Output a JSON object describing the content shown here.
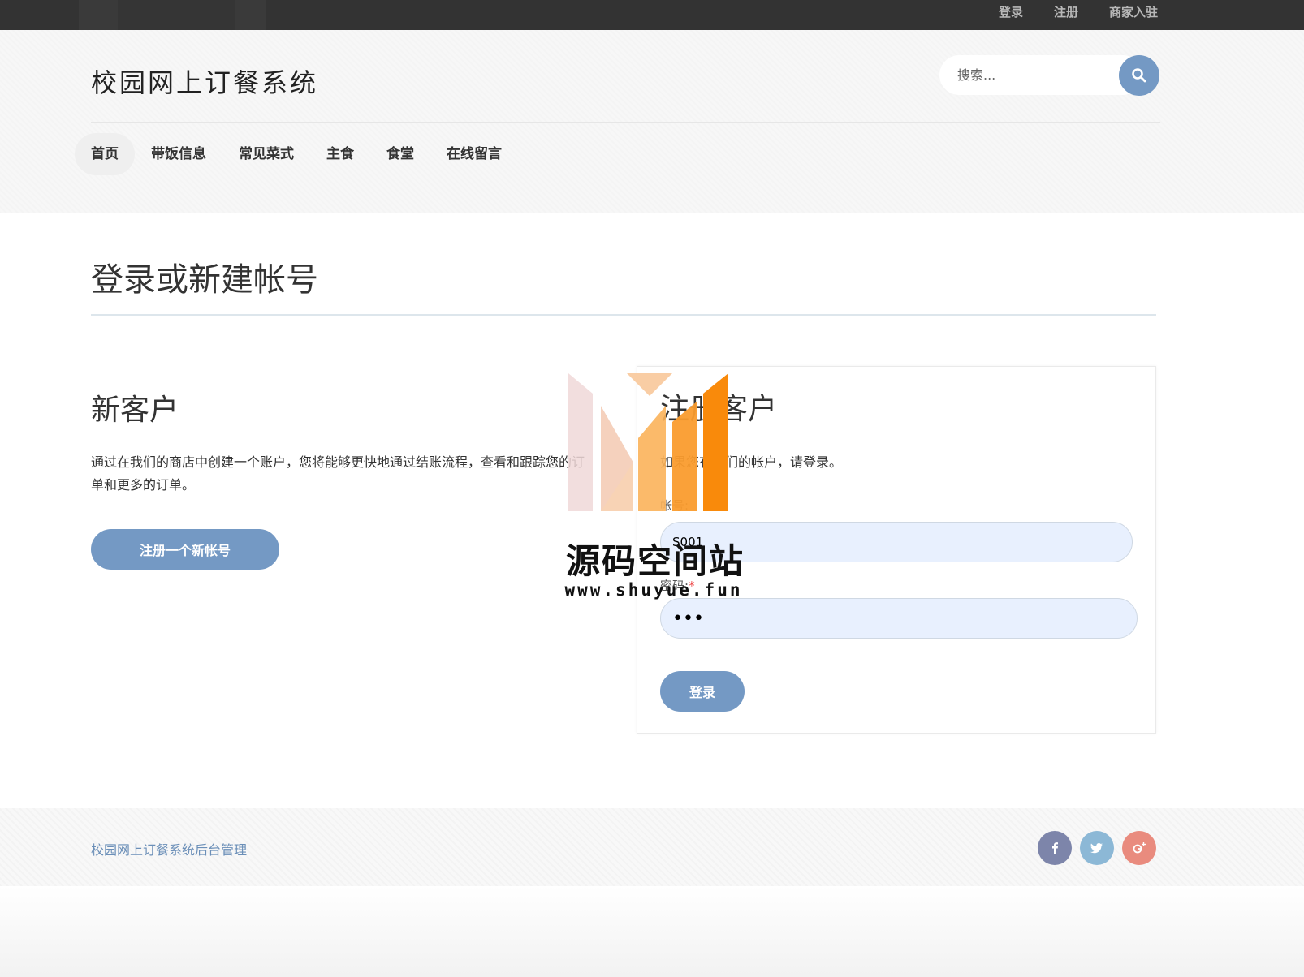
{
  "topbar": {
    "links": [
      "登录",
      "注册",
      "商家入驻"
    ]
  },
  "header": {
    "site_title": "校园网上订餐系统",
    "search_placeholder": "搜索..."
  },
  "nav": {
    "items": [
      "首页",
      "带饭信息",
      "常见菜式",
      "主食",
      "食堂",
      "在线留言"
    ],
    "active": "首页"
  },
  "main": {
    "page_title": "登录或新建帐号",
    "new_customer": {
      "heading": "新客户",
      "text": "通过在我们的商店中创建一个账户，您将能够更快地通过结账流程，查看和跟踪您的订单和更多的订单。",
      "button": "注册一个新帐号"
    },
    "registered_customer": {
      "heading": "注册客户",
      "text": "如果您有我们的帐户，请登录。",
      "account_label": "帐号:",
      "account_value": "S001",
      "password_label": "密码:",
      "password_required": "*",
      "password_value": "123",
      "button": "登录"
    }
  },
  "watermark": {
    "title": "源码空间站",
    "url": "www.shuyue.fun"
  },
  "footer": {
    "admin_link": "校园网上订餐系统后台管理",
    "social_icons": [
      "facebook-icon",
      "twitter-icon",
      "google-plus-icon"
    ]
  },
  "colors": {
    "accent": "#7499c4",
    "topbar": "#333333",
    "footer_link": "#6b8fb8"
  }
}
